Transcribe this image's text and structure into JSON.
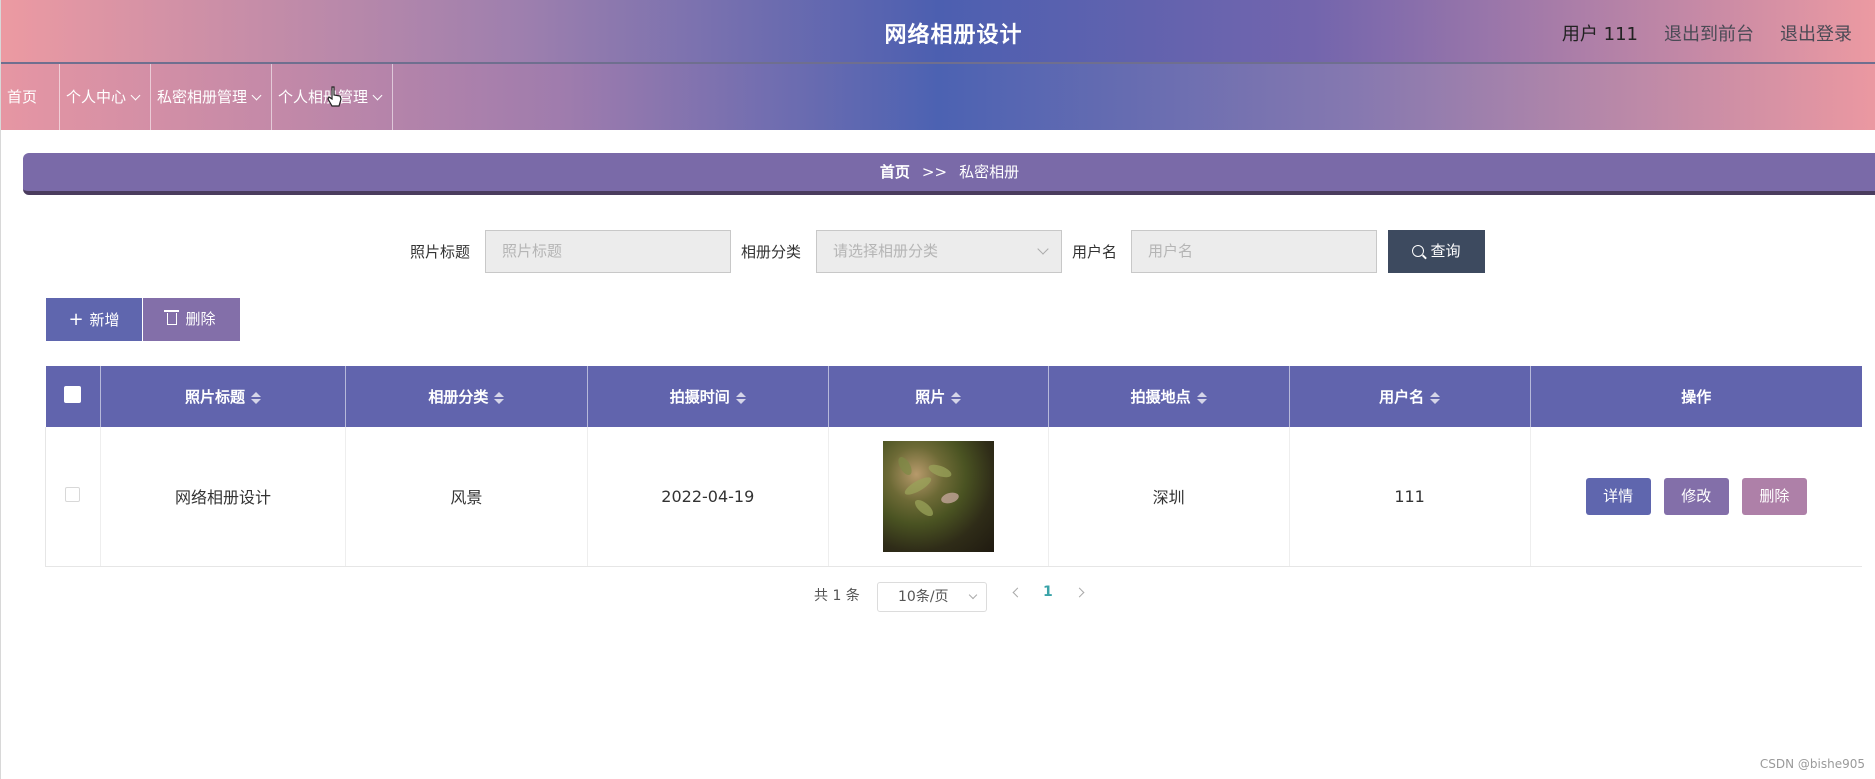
{
  "header": {
    "title": "网络相册设计",
    "user_label": "用户 111",
    "back_to_front": "退出到前台",
    "logout": "退出登录"
  },
  "nav": {
    "items": [
      {
        "label": "首页",
        "has_dropdown": false
      },
      {
        "label": "个人中心",
        "has_dropdown": true
      },
      {
        "label": "私密相册管理",
        "has_dropdown": true
      },
      {
        "label": "个人相册管理",
        "has_dropdown": true
      }
    ]
  },
  "breadcrumb": {
    "home": "首页",
    "separator": ">>",
    "current": "私密相册"
  },
  "search": {
    "title_label": "照片标题",
    "title_placeholder": "照片标题",
    "category_label": "相册分类",
    "category_placeholder": "请选择相册分类",
    "username_label": "用户名",
    "username_placeholder": "用户名",
    "query_button": "查询"
  },
  "actions": {
    "add": "新增",
    "delete": "删除"
  },
  "table": {
    "columns": [
      "照片标题",
      "相册分类",
      "拍摄时间",
      "照片",
      "拍摄地点",
      "用户名",
      "操作"
    ],
    "rows": [
      {
        "title": "网络相册设计",
        "category": "风景",
        "date": "2022-04-19",
        "location": "深圳",
        "username": "111",
        "op_detail": "详情",
        "op_edit": "修改",
        "op_delete": "删除"
      }
    ]
  },
  "pagination": {
    "total": "共 1 条",
    "page_size": "10条/页",
    "current_page": "1"
  },
  "watermark": "CSDN @bishe905",
  "colors": {
    "table_header": "#6164ad",
    "detail_button": "#5f66ae",
    "edit_button": "#836fa9",
    "delete_button": "#ae80a8",
    "query_button": "#3d4a5f"
  }
}
